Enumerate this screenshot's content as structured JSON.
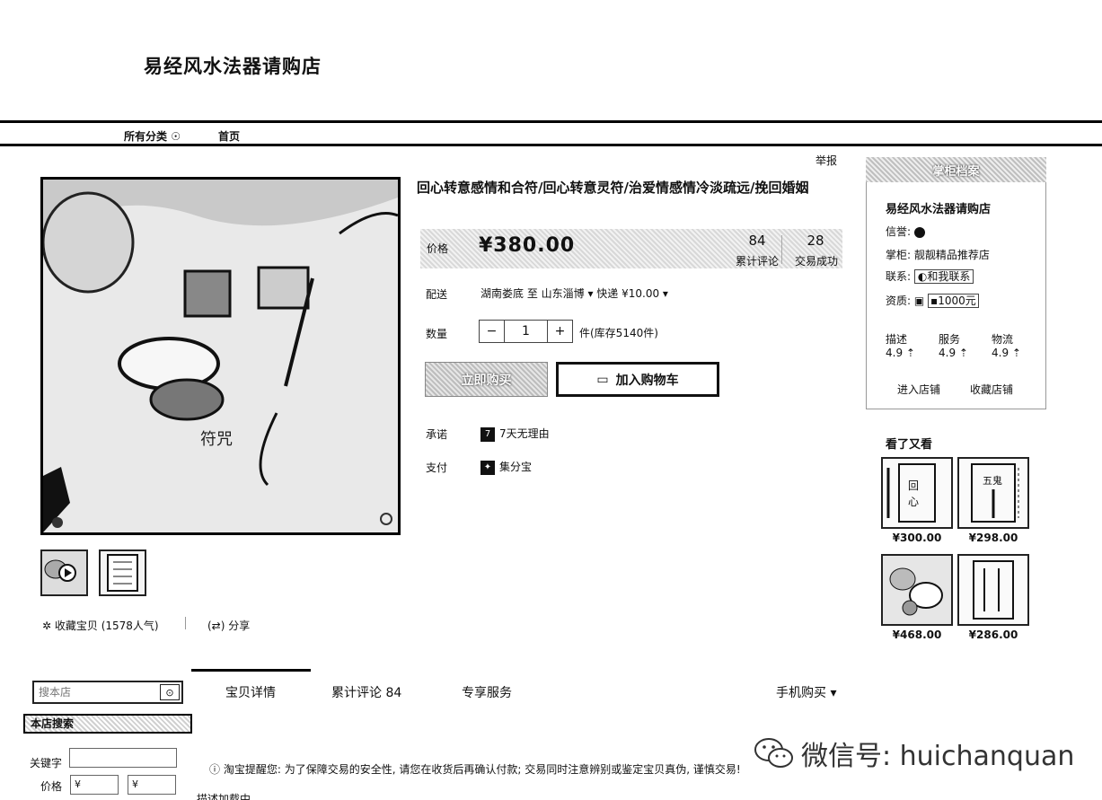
{
  "header": {
    "shop_title": "易经风水法器请购店",
    "nav_all": "所有分类",
    "nav_home": "首页",
    "report": "举报"
  },
  "product": {
    "title": "回心转意感情和合符/回心转意灵符/治爱情感情冷淡疏远/挽回婚姻",
    "price_label": "价格",
    "price": "¥380.00",
    "reviews_count": "84",
    "reviews_label": "累计评论",
    "sales_count": "28",
    "sales_label": "交易成功",
    "ship_label": "配送",
    "ship_text": "湖南娄底 至  山东淄博 ▾   快递 ¥10.00 ▾",
    "qty_label": "数量",
    "qty_minus": "−",
    "qty_value": "1",
    "qty_plus": "+",
    "stock": "件(库存5140件)",
    "buy_now": "立即购买",
    "add_cart": "加入购物车",
    "promise_label": "承诺",
    "promise_value": "7天无理由",
    "pay_label": "支付",
    "pay_value": "集分宝",
    "favorite": "收藏宝贝 (1578人气)",
    "share": "分享"
  },
  "shop_card": {
    "header": "掌柜档案",
    "name": "易经风水法器请购店",
    "credit_label": "信誉:",
    "keeper_label": "掌柜:",
    "keeper_value": "靓靓精品推荐店",
    "contact_label": "联系:",
    "contact_value": "和我联系",
    "qual_label": "资质:",
    "qual_value": "1000元",
    "ratings": [
      {
        "label": "描述",
        "value": "4.9 ⇡"
      },
      {
        "label": "服务",
        "value": "4.9 ⇡"
      },
      {
        "label": "物流",
        "value": "4.9 ⇡"
      }
    ],
    "enter_shop": "进入店铺",
    "fav_shop": "收藏店铺"
  },
  "also_viewed": {
    "title": "看了又看",
    "items": [
      {
        "price": "¥300.00"
      },
      {
        "price": "¥298.00"
      },
      {
        "price": "¥468.00"
      },
      {
        "price": "¥286.00"
      }
    ]
  },
  "tabs": {
    "detail": "宝贝详情",
    "reviews": "累计评论  84",
    "service": "专享服务",
    "mobile": "手机购买 ▾"
  },
  "sidebar_search": {
    "placeholder": "搜本店",
    "bar_title": "本店搜索",
    "kw_label": "关键字",
    "price_label": "价格",
    "price_from": "¥",
    "price_to": "¥"
  },
  "footer": {
    "reminder": "淘宝提醒您: 为了保障交易的安全性, 请您在收货后再确认付款; 交易同时注意辨别或鉴定宝贝真伪, 谨慎交易!",
    "loading": "描述加载中",
    "watermark": "微信号: huichanquan"
  }
}
